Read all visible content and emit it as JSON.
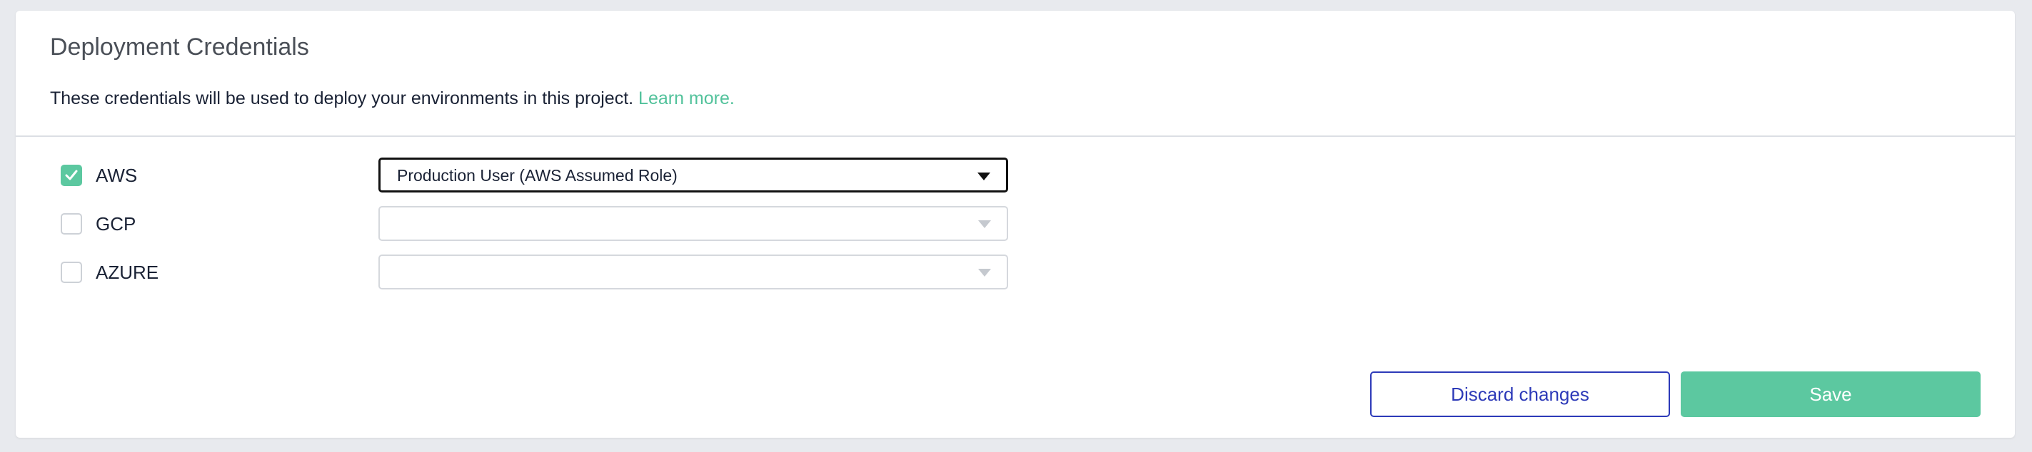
{
  "header": {
    "title": "Deployment Credentials",
    "description": "These credentials will be used to deploy your environments in this project.",
    "learn_more": "Learn more."
  },
  "providers": [
    {
      "label": "AWS",
      "checked": true,
      "selected_value": "Production User (AWS Assumed Role)"
    },
    {
      "label": "GCP",
      "checked": false,
      "selected_value": ""
    },
    {
      "label": "AZURE",
      "checked": false,
      "selected_value": ""
    }
  ],
  "actions": {
    "discard_label": "Discard changes",
    "save_label": "Save"
  },
  "colors": {
    "accent": "#5cc8a0",
    "link": "#52c29b",
    "discard": "#2d3ab8"
  },
  "icons": {
    "check": "check-icon",
    "dropdown": "chevron-down-icon"
  }
}
